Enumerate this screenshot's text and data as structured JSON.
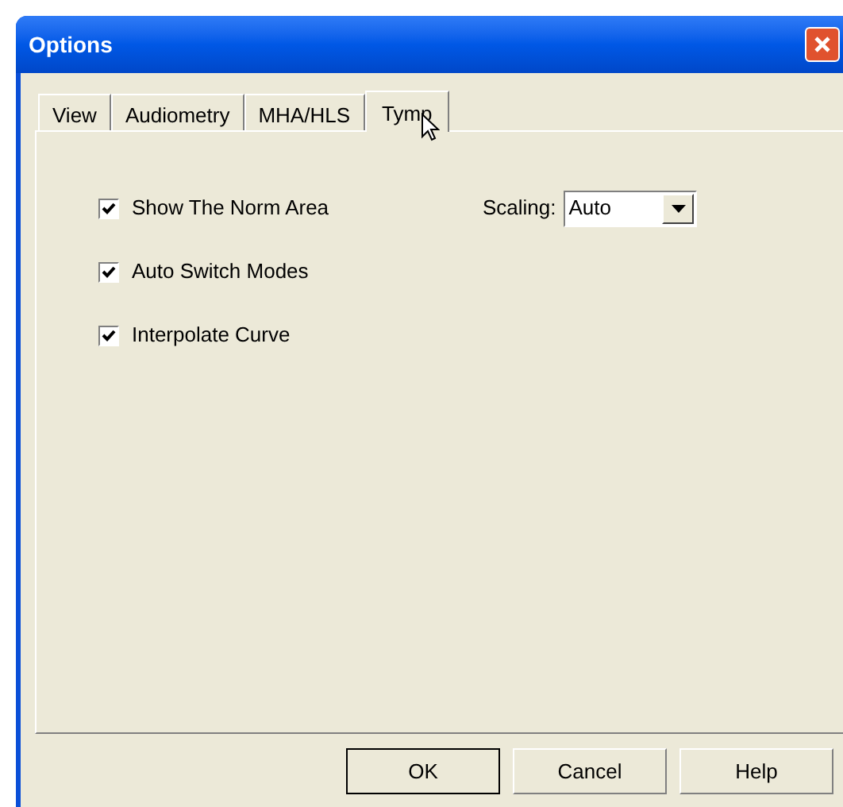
{
  "window": {
    "title": "Options"
  },
  "tabs": [
    {
      "label": "View",
      "selected": false
    },
    {
      "label": "Audiometry",
      "selected": false
    },
    {
      "label": "MHA/HLS",
      "selected": false
    },
    {
      "label": "Tymp",
      "selected": true
    }
  ],
  "options": [
    {
      "label": "Show The Norm Area",
      "checked": true
    },
    {
      "label": "Auto Switch Modes",
      "checked": true
    },
    {
      "label": "Interpolate Curve",
      "checked": true
    }
  ],
  "scaling": {
    "label": "Scaling:",
    "value": "Auto"
  },
  "buttons": [
    {
      "label": "OK",
      "default": true
    },
    {
      "label": "Cancel",
      "default": false
    },
    {
      "label": "Help",
      "default": false
    }
  ]
}
